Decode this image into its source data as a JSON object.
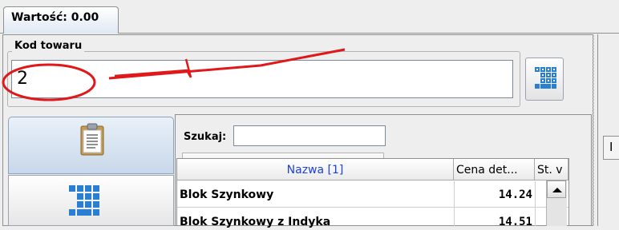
{
  "tab": {
    "label": "Wartość: 0.00"
  },
  "product_code": {
    "group_label": "Kod towaru",
    "value": "2"
  },
  "search": {
    "label": "Szukaj:",
    "value": ""
  },
  "table": {
    "columns": [
      "Nazwa [1]",
      "Cena det...",
      "St. v"
    ],
    "rows": [
      {
        "name": "Blok Szynkowy",
        "price": "14.24"
      },
      {
        "name": "Blok Szynkowy z Indyka",
        "price": "14.51"
      }
    ]
  },
  "right_strip": {
    "label": "I"
  },
  "colors": {
    "annotation": "#e0181a",
    "header_link": "#1d3fdc",
    "tab_bg": "#dfe8f3"
  },
  "icons": [
    "keypad-icon",
    "clipboard-icon",
    "keypad-icon",
    "scroll-up-arrow-icon"
  ]
}
